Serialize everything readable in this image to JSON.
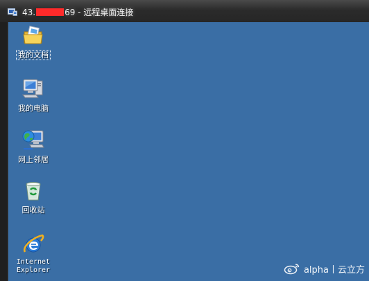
{
  "window": {
    "title_prefix": "43.",
    "title_suffix": "69 - 远程桌面连接"
  },
  "desktop": {
    "background_color": "#3a6ea5",
    "icons": [
      {
        "label": "我的文档",
        "icon": "my-documents-folder-icon"
      },
      {
        "label": "我的电脑",
        "icon": "my-computer-icon"
      },
      {
        "label": "网上邻居",
        "icon": "network-places-icon"
      },
      {
        "label": "回收站",
        "icon": "recycle-bin-icon"
      },
      {
        "label": "Internet\nExplorer",
        "icon": "internet-explorer-icon"
      }
    ]
  },
  "watermark": {
    "text": "alpha丨云立方",
    "icon": "weibo-icon"
  }
}
